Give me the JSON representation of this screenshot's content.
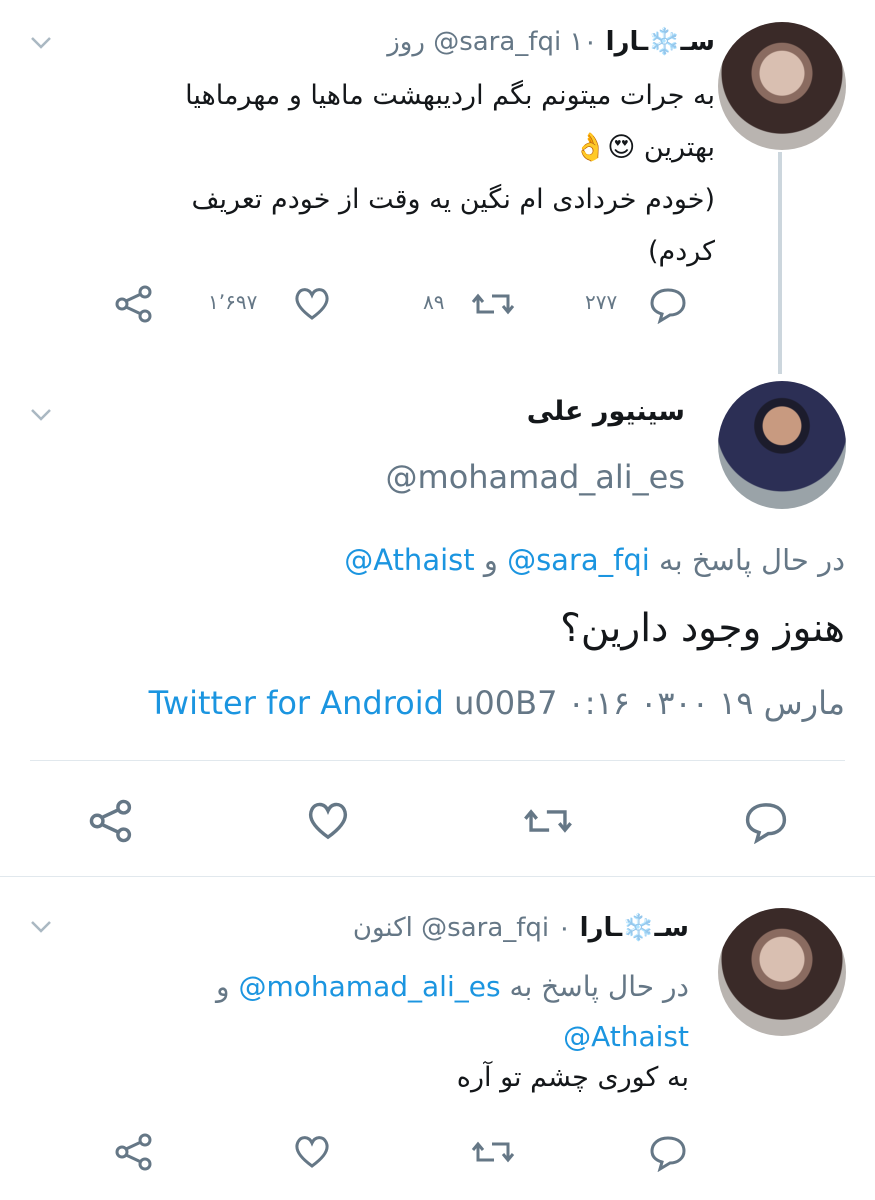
{
  "tweet1": {
    "display_name": "سـ❄️ـارا",
    "handle": "@sara_fqi",
    "time": "۱۰ روز",
    "lines": [
      "به جرات میتونم بگم اردیبهشت ماهیا و مهرماهیا",
      "بهترین 😍👌",
      "(خودم خردادی ام نگین یه وقت از خودم تعریف",
      "کردم)"
    ],
    "replies": "۲۷۷",
    "retweets": "۸۹",
    "likes": "۱٬۶۹۷"
  },
  "tweet2": {
    "display_name": "سینیور علی",
    "handle": "@mohamad_ali_es",
    "replying_prefix": "در حال پاسخ به",
    "reply_handle_1": "@sara_fqi",
    "reply_and": "و",
    "reply_handle_2": "@Athaist",
    "text": "هنوز وجود دارین؟",
    "timestamp": "۰:۱۶ ۰۳۰۰ مارس ۱۹",
    "source_sep": "u00B7",
    "source": "Twitter for Android"
  },
  "tweet3": {
    "display_name": "سـ❄️ـارا",
    "handle": "@sara_fqi",
    "time": "۰ اکنون",
    "replying_prefix": "در حال پاسخ به",
    "reply_handle_1": "@mohamad_ali_es",
    "reply_and": "و",
    "reply_handle_2": "@Athaist",
    "text": "به کوری چشم تو آره"
  },
  "colors": {
    "link": "#1b95e0",
    "gray": "#657786",
    "icon": "#657786",
    "thread_line": "#ccd6dd",
    "divider": "#e1e8ed"
  },
  "icons": [
    "chevron-down-icon",
    "share-icon",
    "heart-icon",
    "retweet-icon",
    "reply-icon"
  ]
}
